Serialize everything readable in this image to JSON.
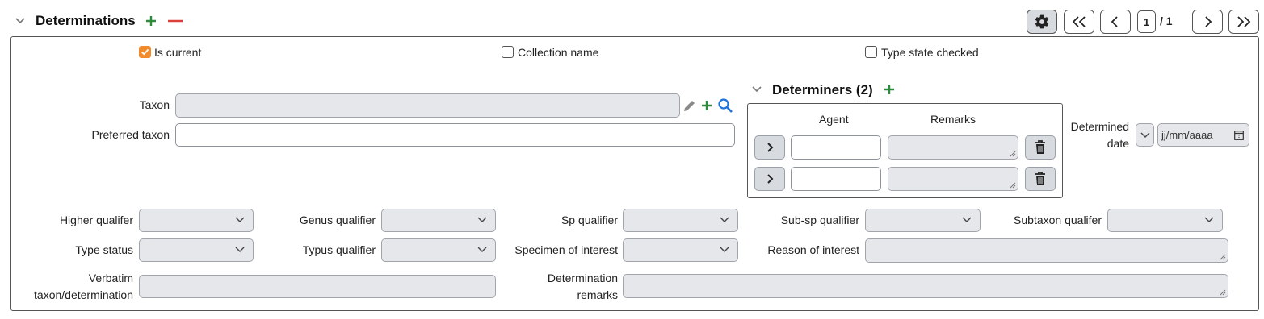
{
  "section": {
    "title": "Determinations",
    "page_current": "1",
    "page_total": "/ 1"
  },
  "checkboxes": {
    "is_current": "Is current",
    "is_current_checked": true,
    "collection_name": "Collection name",
    "type_state_checked": "Type state checked"
  },
  "fields": {
    "taxon_label": "Taxon",
    "preferred_taxon_label": "Preferred taxon",
    "higher_qualifier_label": "Higher qualifer",
    "genus_qualifier_label": "Genus qualifier",
    "sp_qualifier_label": "Sp qualifier",
    "subsp_qualifier_label": "Sub-sp qualifier",
    "subtaxon_qualifier_label": "Subtaxon qualifer",
    "type_status_label": "Type status",
    "typus_qualifier_label": "Typus qualifier",
    "specimen_interest_label": "Specimen of interest",
    "reason_interest_label": "Reason of interest",
    "verbatim_label_1": "Verbatim",
    "verbatim_label_2": "taxon/determination",
    "det_remarks_label_1": "Determination",
    "det_remarks_label_2": "remarks"
  },
  "determiners": {
    "title": "Determiners (2)",
    "col_agent": "Agent",
    "col_remarks": "Remarks",
    "rows": 2
  },
  "determined_date": {
    "label_1": "Determined",
    "label_2": "date",
    "placeholder": "jj/mm/aaaa"
  },
  "colors": {
    "add": "#2e8b3e",
    "remove": "#d9403a",
    "search": "#1e73d8",
    "checkbox_on": "#f28b2c",
    "field_bg": "#e5e7eb"
  }
}
